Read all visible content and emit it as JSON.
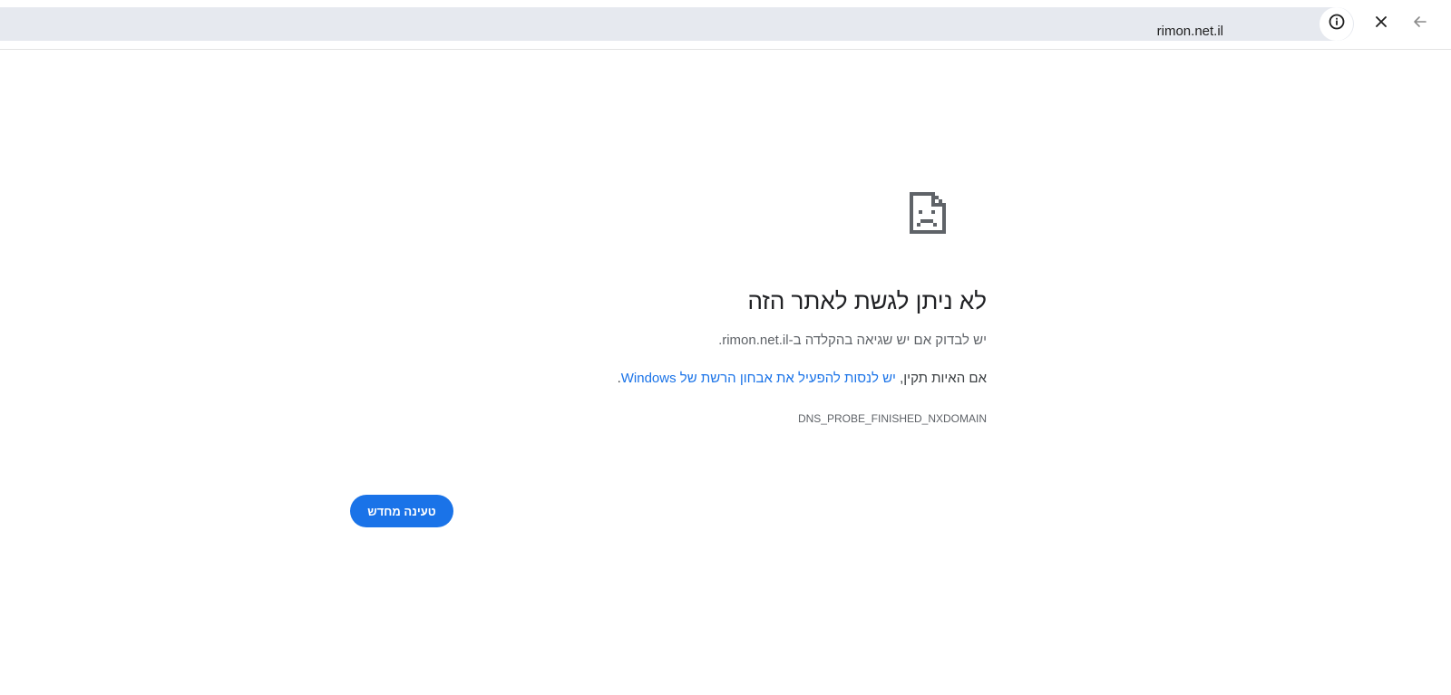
{
  "address_bar": {
    "url": "rimon.net.il",
    "bg_color": "#e6e9ef"
  },
  "icons": {
    "info": "info-circle-icon",
    "close": "close-icon",
    "back": "arrow-back-icon",
    "error": "sad-document-icon"
  },
  "error_page": {
    "heading": "לא ניתן לגשת לאתר הזה",
    "subtext_prefix": "יש לבדוק אם יש שגיאה בהקלדה ב-",
    "subtext_domain": "rimon.net.il",
    "subtext_suffix": ".",
    "suggestion_prefix": "אם האיות תקין, ",
    "suggestion_link": "יש לנסות להפעיל את אבחון הרשת של Windows",
    "suggestion_suffix": ".",
    "error_code": "DNS_PROBE_FINISHED_NXDOMAIN",
    "reload_label": "טעינה מחדש"
  },
  "colors": {
    "accent": "#1a73e8",
    "heading": "#202124",
    "secondary_text": "#5f6368"
  }
}
